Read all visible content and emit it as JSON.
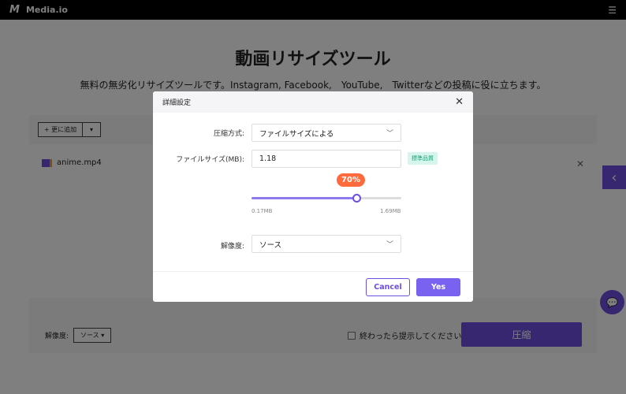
{
  "header": {
    "logo": "M",
    "brand": "Media.io",
    "menu_icon": "hamburger-icon"
  },
  "page": {
    "title": "動画リサイズツール",
    "subtitle": "無料の無劣化リサイズツールです。Instagram, Facebook,　YouTube,　Twitterなどの投稿に役に立ちます。"
  },
  "panel": {
    "add_more": "+ 更に追加",
    "dropdown": "▾",
    "file_name": "anime.mp4",
    "resolution_label": "解像度:",
    "resolution_value": "ソース ▾",
    "notify_label": "終わったら提示してください",
    "compress": "圧縮"
  },
  "dialog": {
    "title": "詳細設定",
    "method_label": "圧縮方式:",
    "method_value": "ファイルサイズによる",
    "size_label": "ファイルサイズ(MB):",
    "size_value": "1.18",
    "quality_tag": "標準品質",
    "percent_label": "70%",
    "percent": 70,
    "min": "0.17MB",
    "max": "1.69MB",
    "resolution_label": "解像度:",
    "resolution_value": "ソース",
    "cancel": "Cancel",
    "yes": "Yes"
  },
  "colors": {
    "accent": "#6c4fe0",
    "badge": "#ff6a3d"
  }
}
